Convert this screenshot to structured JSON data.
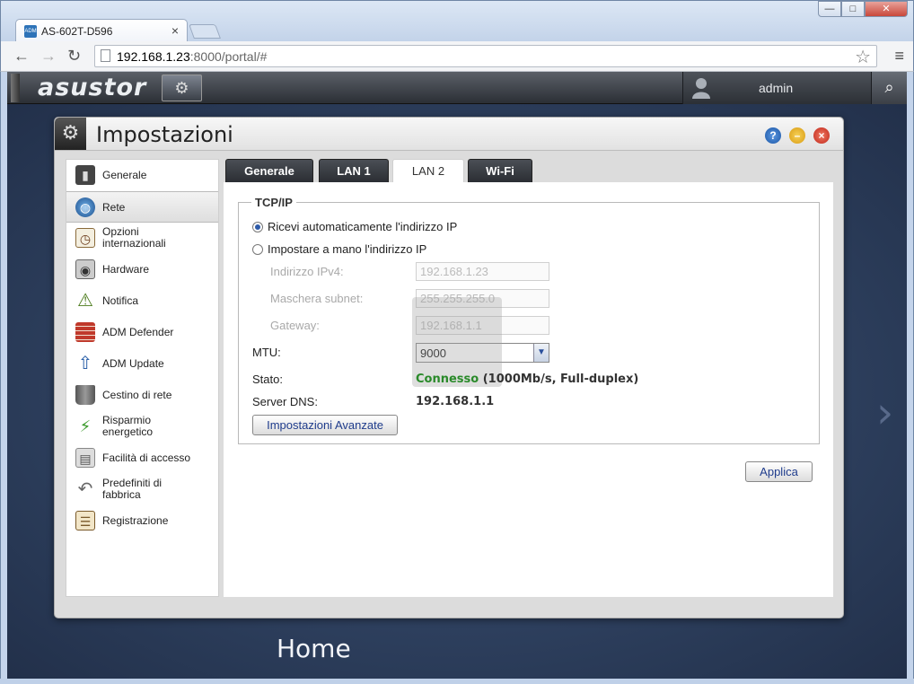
{
  "browser": {
    "tab_title": "AS-602T-D596",
    "tab_close": "×",
    "url_host": "192.168.1.23",
    "url_rest": ":8000/portal/#",
    "window_min": "—",
    "window_max": "□",
    "window_close": "✕"
  },
  "adm": {
    "logo": "asustor",
    "username": "admin"
  },
  "window": {
    "title": "Impostazioni",
    "help": "?",
    "minimize": "–",
    "close": "×"
  },
  "sidebar": {
    "items": [
      {
        "label": "Generale",
        "icon": "server-icon"
      },
      {
        "label": "Rete",
        "icon": "globe-icon"
      },
      {
        "label": "Opzioni internazionali",
        "icon": "calendar-clock-icon"
      },
      {
        "label": "Hardware",
        "icon": "harddisk-icon"
      },
      {
        "label": "Notifica",
        "icon": "warning-icon"
      },
      {
        "label": "ADM Defender",
        "icon": "firewall-icon"
      },
      {
        "label": "ADM Update",
        "icon": "update-arrow-icon"
      },
      {
        "label": "Cestino di rete",
        "icon": "trash-icon"
      },
      {
        "label": "Risparmio energetico",
        "icon": "lightning-icon"
      },
      {
        "label": "Facilità di accesso",
        "icon": "printer-icon"
      },
      {
        "label": "Predefiniti di fabbrica",
        "icon": "undo-icon"
      },
      {
        "label": "Registrazione",
        "icon": "clipboard-icon"
      }
    ]
  },
  "tabs": [
    "Generale",
    "LAN 1",
    "LAN 2",
    "Wi-Fi"
  ],
  "tcpip": {
    "legend": "TCP/IP",
    "radio_auto": "Ricevi automaticamente l'indirizzo IP",
    "radio_manual": "Impostare a mano l'indirizzo IP",
    "ipv4_label": "Indirizzo IPv4:",
    "ipv4_value": "192.168.1.23",
    "subnet_label": "Maschera subnet:",
    "subnet_value": "255.255.255.0",
    "gateway_label": "Gateway:",
    "gateway_value": "192.168.1.1",
    "mtu_label": "MTU:",
    "mtu_value": "9000",
    "status_label": "Stato:",
    "status_connected": "Connesso",
    "status_detail": " (1000Mb/s, Full-duplex)",
    "dns_label": "Server DNS:",
    "dns_value": "192.168.1.1",
    "advanced_button": "Impostazioni Avanzate"
  },
  "apply_button": "Applica",
  "desktop": {
    "home_label": "Home",
    "next_arrow": "›"
  }
}
